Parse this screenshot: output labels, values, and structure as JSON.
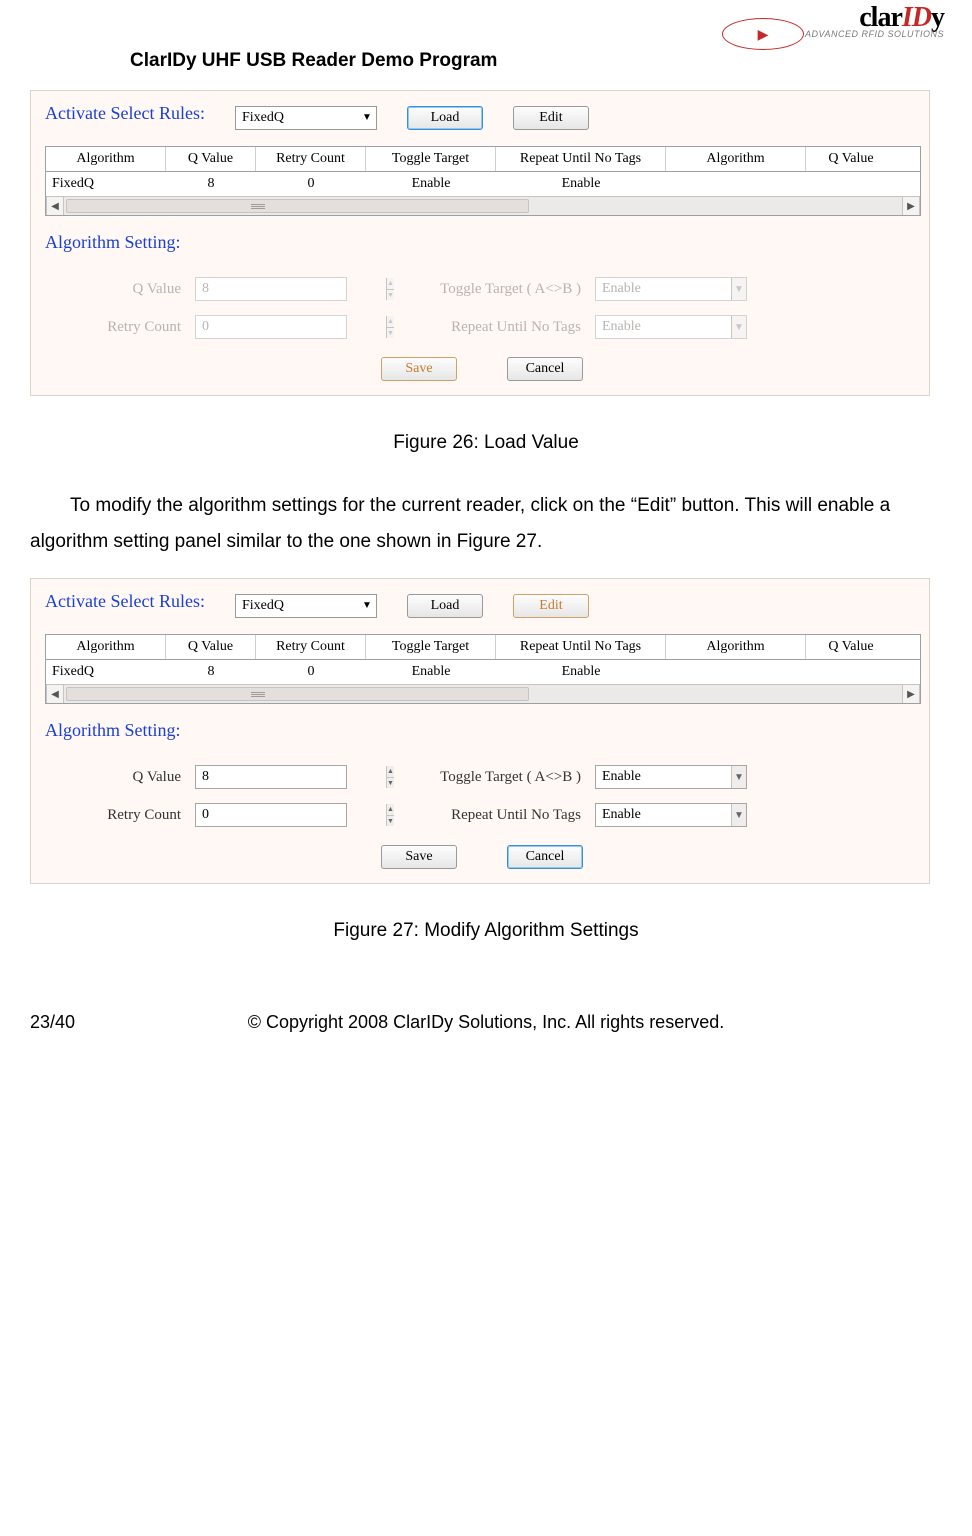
{
  "doc": {
    "title": "ClarIDy UHF USB Reader Demo Program",
    "logo": {
      "a": "clar",
      "b": "ID",
      "c": "y",
      "sub": "ADVANCED RFID SOLUTIONS"
    }
  },
  "panel1": {
    "rules_label": "Activate Select Rules:",
    "rules_combo": "FixedQ",
    "load_btn": "Load",
    "edit_btn": "Edit",
    "headers": [
      "Algorithm",
      "Q Value",
      "Retry Count",
      "Toggle Target",
      "Repeat Until No Tags",
      "Algorithm",
      "Q Value"
    ],
    "row": [
      "FixedQ",
      "8",
      "0",
      "Enable",
      "Enable",
      "",
      ""
    ],
    "algo_label": "Algorithm Setting:",
    "q_label": "Q Value",
    "q_val": "8",
    "retry_label": "Retry Count",
    "retry_val": "0",
    "toggle_label": "Toggle Target ( A<>B )",
    "toggle_val": "Enable",
    "repeat_label": "Repeat Until No Tags",
    "repeat_val": "Enable",
    "save_btn": "Save",
    "cancel_btn": "Cancel"
  },
  "fig26": "Figure 26: Load Value",
  "para": "To modify the algorithm settings for the current reader, click on the “Edit” button. This will enable a algorithm setting panel similar to the one shown in Figure 27.",
  "panel2": {
    "rules_label": "Activate Select Rules:",
    "rules_combo": "FixedQ",
    "load_btn": "Load",
    "edit_btn": "Edit",
    "headers": [
      "Algorithm",
      "Q Value",
      "Retry Count",
      "Toggle Target",
      "Repeat Until No Tags",
      "Algorithm",
      "Q Value"
    ],
    "row": [
      "FixedQ",
      "8",
      "0",
      "Enable",
      "Enable",
      "",
      ""
    ],
    "algo_label": "Algorithm Setting:",
    "q_label": "Q Value",
    "q_val": "8",
    "retry_label": "Retry Count",
    "retry_val": "0",
    "toggle_label": "Toggle Target ( A<>B )",
    "toggle_val": "Enable",
    "repeat_label": "Repeat Until No Tags",
    "repeat_val": "Enable",
    "save_btn": "Save",
    "cancel_btn": "Cancel"
  },
  "fig27": "Figure 27: Modify Algorithm Settings",
  "footer": {
    "page": "23/40",
    "copyright": "© Copyright 2008 ClarIDy Solutions, Inc. All rights reserved."
  }
}
